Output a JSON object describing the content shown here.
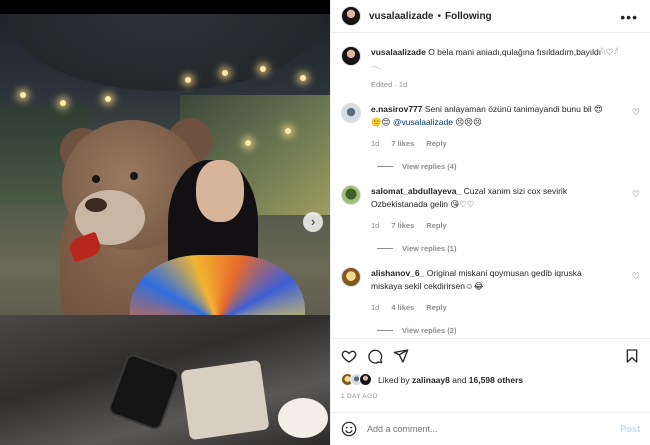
{
  "post": {
    "username": "vusalaalizade",
    "follow_status": "Following",
    "header_dot": "•",
    "more": "•••",
    "caption_user": "vusalaalizade",
    "caption": "O bela mani aniadı,qulağına fısıldadım,bayıldı𓆩♡𓆪",
    "caption_line2": "𓂃",
    "edited": "Edited · 1d"
  },
  "comments": [
    {
      "user": "e.nasirov777",
      "text": "Seni anlayaman özünü tanimayandi bunu bil 😍",
      "line2_prefix": "🙁😊",
      "mention": "@vusalaalizade",
      "line2_suffix": "😣😣😣",
      "age": "1d",
      "likes": "7 likes",
      "reply": "Reply",
      "view_replies": "View replies (4)"
    },
    {
      "user": "salomat_abdullayeva_",
      "text": "Cuzal xanim sizi cox sevirik",
      "line2": "Ozbekistanada gelin 😘♡♡",
      "age": "1d",
      "likes": "7 likes",
      "reply": "Reply",
      "view_replies": "View replies (1)"
    },
    {
      "user": "alishanov_6_",
      "text": "Original miskani qoymusan gedib iqruska",
      "line2": "miskaya sekil cekdirirsen☺😂",
      "age": "1d",
      "likes": "4 likes",
      "reply": "Reply",
      "view_replies": "View replies (2)"
    }
  ],
  "likes": {
    "prefix": "Liked by",
    "user": "zalinaay8",
    "and": "and",
    "count": "16,598 others"
  },
  "timestamp": "1 DAY AGO",
  "add_comment": {
    "placeholder": "Add a comment...",
    "post_label": "Post"
  },
  "icons": {
    "more": "more-icon",
    "heart": "heart-icon",
    "comment": "comment-icon",
    "share": "share-icon",
    "bookmark": "bookmark-icon",
    "emoji": "emoji-icon",
    "next": "chevron-right-icon"
  },
  "colors": {
    "link": "#00376b",
    "muted": "#8e8e8e",
    "post_disabled": "#b2dffc"
  }
}
